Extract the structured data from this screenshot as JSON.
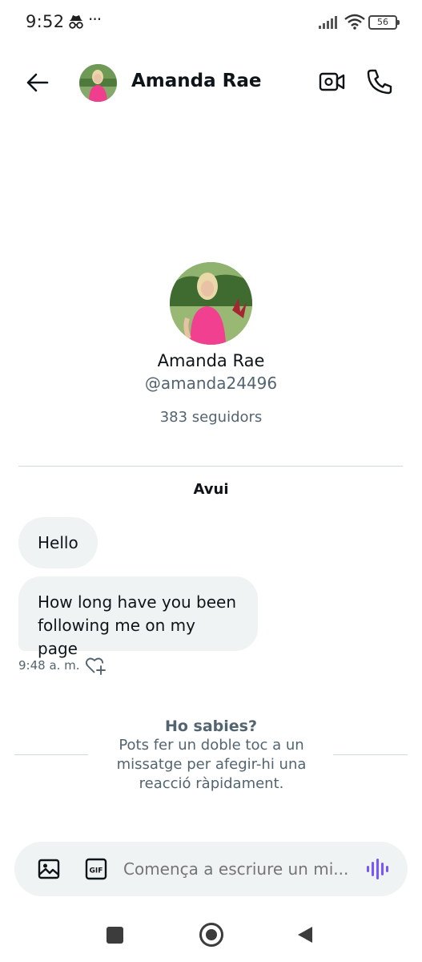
{
  "status_bar": {
    "time": "9:52",
    "overflow": "···",
    "battery": "56",
    "icons": [
      "incognito-icon",
      "signal-icon",
      "wifi-icon",
      "battery-icon"
    ]
  },
  "header": {
    "name": "Amanda Rae",
    "icons": [
      "back-arrow-icon",
      "video-call-icon",
      "phone-icon"
    ]
  },
  "profile": {
    "name": "Amanda Rae",
    "handle": "@amanda24496",
    "followers": "383 seguidors"
  },
  "conversation": {
    "day_label": "Avui",
    "messages": [
      {
        "text": "Hello"
      },
      {
        "text": "How long have you been following me on my page"
      }
    ],
    "time": "9:48 a. m."
  },
  "tip": {
    "title": "Ho sabies?",
    "body": "Pots fer un doble toc a un missatge per afegir-hi una reacció ràpidament."
  },
  "composer": {
    "placeholder": "Comença a escriure un mi...",
    "icons": [
      "image-icon",
      "gif-icon",
      "voice-icon"
    ]
  },
  "colors": {
    "accent_voice": "#7856ff",
    "bubble": "#eff3f4",
    "secondary_text": "#536471"
  }
}
